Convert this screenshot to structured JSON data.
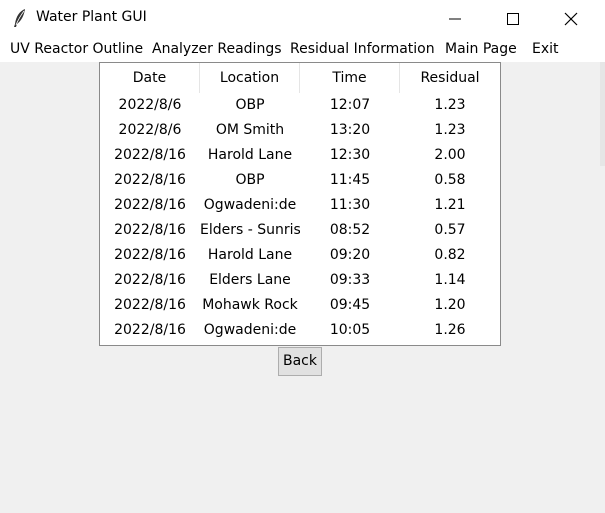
{
  "window": {
    "title": "Water Plant GUI",
    "icon": "feather-icon"
  },
  "menu": {
    "items": [
      "UV Reactor Outline",
      "Analyzer Readings",
      "Residual Information",
      "Main Page",
      "Exit"
    ]
  },
  "table": {
    "columns": [
      "Date",
      "Location",
      "Time",
      "Residual"
    ],
    "rows": [
      [
        "2022/8/6",
        "OBP",
        "12:07",
        "1.23"
      ],
      [
        "2022/8/6",
        "OM Smith",
        "13:20",
        "1.23"
      ],
      [
        "2022/8/16",
        "Harold Lane",
        "12:30",
        "2.00"
      ],
      [
        "2022/8/16",
        "OBP",
        "11:45",
        "0.58"
      ],
      [
        "2022/8/16",
        "Ogwadeni:de",
        "11:30",
        "1.21"
      ],
      [
        "2022/8/16",
        "Elders - Sunris",
        "08:52",
        "0.57"
      ],
      [
        "2022/8/16",
        "Harold Lane",
        "09:20",
        "0.82"
      ],
      [
        "2022/8/16",
        "Elders Lane",
        "09:33",
        "1.14"
      ],
      [
        "2022/8/16",
        "Mohawk Rock",
        "09:45",
        "1.20"
      ],
      [
        "2022/8/16",
        "Ogwadeni:de",
        "10:05",
        "1.26"
      ]
    ]
  },
  "back_label": "Back"
}
